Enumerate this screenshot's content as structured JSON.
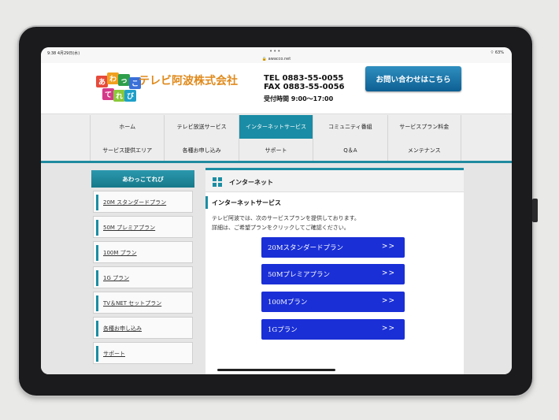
{
  "status": {
    "time": "9:38  4月29日(水)",
    "url": "awacco.net",
    "battery": "63%"
  },
  "header": {
    "logo_text": [
      "あ",
      "わ",
      "っ",
      "こ",
      "て",
      "れ",
      "び"
    ],
    "company": "テレビ阿波株式会社",
    "tel": "TEL  0883-55-0055",
    "fax": "FAX  0883-55-0056",
    "hours": "受付時間  9:00〜17:00",
    "contact_button": "お問い合わせはこちら"
  },
  "nav": {
    "row1": [
      "ホーム",
      "テレビ放送サービス",
      "インターネットサービス",
      "コミュニティ番組",
      "サービスプラン料金"
    ],
    "row2": [
      "サービス提供エリア",
      "各種お申し込み",
      "サポート",
      "Q＆A",
      "メンテナンス"
    ],
    "active": "インターネットサービス"
  },
  "sidebar": {
    "title": "あわっこてれび",
    "items": [
      "20M スタンダードプラン",
      "50M プレミアプラン",
      "100M プラン",
      "1G プラン",
      "TV＆NET セットプラン",
      "各種お申し込み",
      "サポート"
    ]
  },
  "main": {
    "section_title": "インターネット",
    "sub_title": "インターネットサービス",
    "desc_line1": "テレビ阿波では、次のサービスプランを提供しております。",
    "desc_line2": "詳細は、ご希望プランをクリックしてご確認ください。",
    "plans": [
      "20Mスタンダードプラン",
      "50Mプレミアプラン",
      "100Mプラン",
      "1Gプラン"
    ],
    "arrow": ">>"
  },
  "colors": {
    "accent": "#1b8da3",
    "plan_button": "#1a2fd6",
    "company": "#e08a1c"
  }
}
